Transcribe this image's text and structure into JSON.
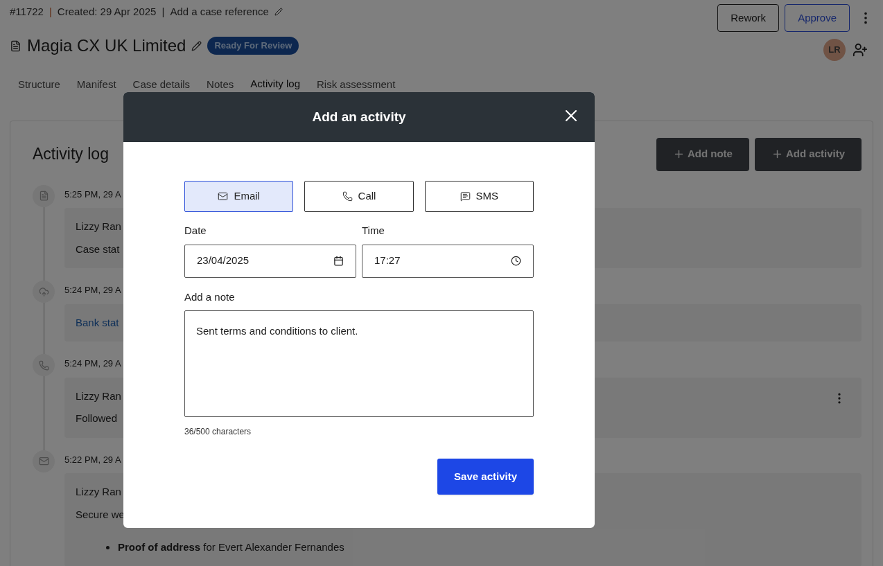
{
  "header": {
    "case_number": "#11722",
    "separators": [
      "|",
      "|"
    ],
    "created": "Created: 29 Apr 2025",
    "reference_link": "Add a case reference",
    "title": "Magia CX UK Limited",
    "status_badge": "Ready For Review",
    "buttons": [
      {
        "label": "Rework",
        "kind": "secondary"
      },
      {
        "label": "Approve",
        "kind": "primary"
      }
    ],
    "avatar": "LR"
  },
  "tabs": [
    {
      "label": "Structure",
      "selected": false
    },
    {
      "label": "Manifest",
      "selected": false
    },
    {
      "label": "Case details",
      "selected": false
    },
    {
      "label": "Notes",
      "selected": false
    },
    {
      "label": "Activity log",
      "selected": true
    },
    {
      "label": "Risk assessment",
      "selected": false
    }
  ],
  "activity_log": {
    "title": "Activity log",
    "buttons": [
      "Add note",
      "Add activity"
    ],
    "entries": [
      {
        "kind": "document",
        "time": "5:25 PM, 29 A",
        "lines": [
          "Lizzy Ran",
          "Case stat"
        ]
      },
      {
        "kind": "upload",
        "time": "5:24 PM, 29 A",
        "link": "Bank stat"
      },
      {
        "kind": "call",
        "time": "5:24 PM, 29 A",
        "lines": [
          "Lizzy Ran",
          "Followed"
        ],
        "menu": true
      },
      {
        "kind": "email",
        "time": "5:22 PM, 29 A",
        "lines": [
          "Lizzy Ran",
          "Secure we"
        ],
        "bullets": [
          "**Proof of address** for Evert Alexander Fernandes"
        ]
      }
    ]
  },
  "dialog": {
    "title": "Add an activity",
    "types": [
      {
        "kind": "email",
        "label": "Email",
        "selected": true
      },
      {
        "kind": "call",
        "label": "Call",
        "selected": false
      },
      {
        "kind": "sms",
        "label": "SMS",
        "selected": false
      }
    ],
    "date": {
      "label": "Date",
      "value": "23/04/2025"
    },
    "time": {
      "label": "Time",
      "value": "17:27"
    },
    "note": {
      "label": "Add a note",
      "value": "Sent terms and conditions to client."
    },
    "counter": "36/500 characters",
    "save": "Save activity"
  }
}
